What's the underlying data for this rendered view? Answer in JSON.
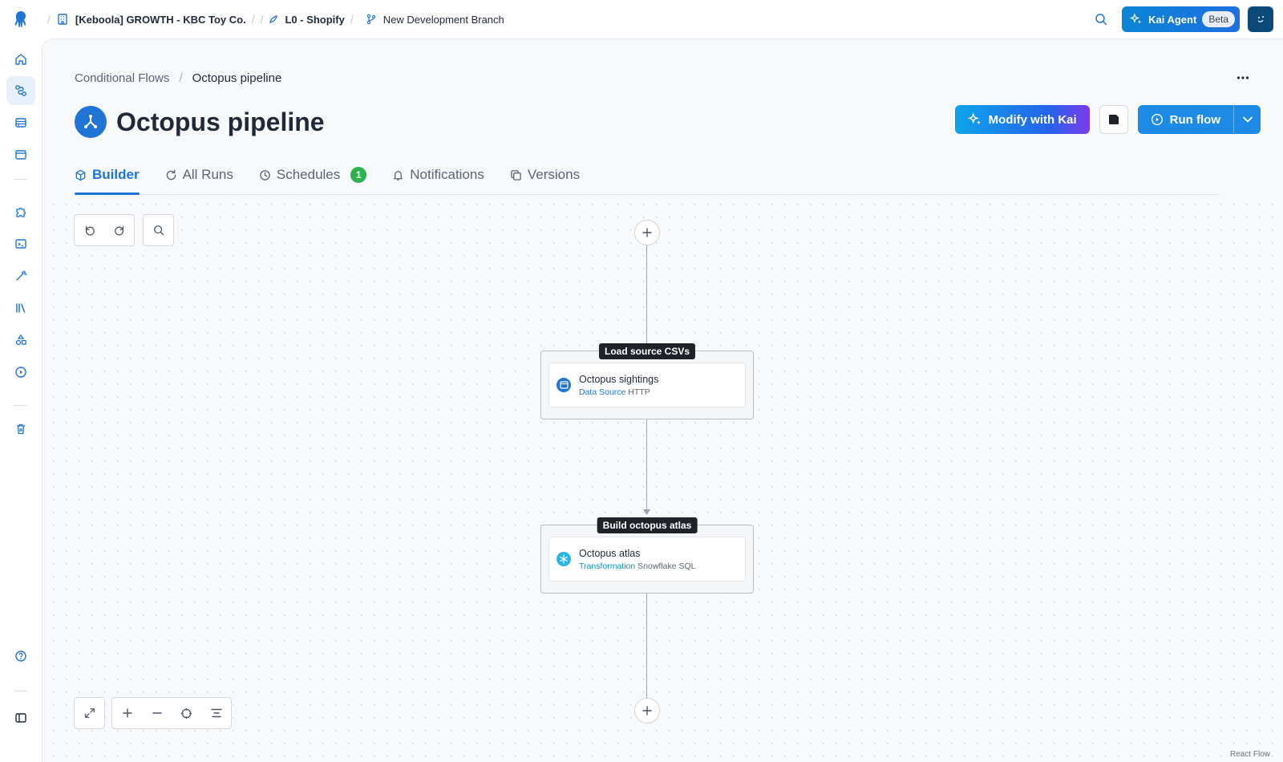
{
  "topbar": {
    "org": "[Keboola] GROWTH - KBC Toy Co.",
    "project": "L0 - Shopify",
    "branch": "New Development Branch",
    "kai_label": "Kai Agent",
    "kai_badge": "Beta"
  },
  "sidebar": {
    "items": [
      "home-icon",
      "flows-icon",
      "storage-icon",
      "components-icon",
      "puzzle-icon",
      "terminal-icon",
      "magic-wand-icon",
      "library-icon",
      "shapes-icon",
      "play-circle-icon",
      "trash-icon",
      "help-icon",
      "panel-toggle-icon"
    ],
    "active": "flows-icon"
  },
  "breadcrumb": {
    "parent": "Conditional Flows",
    "current": "Octopus pipeline"
  },
  "page": {
    "title": "Octopus pipeline"
  },
  "actions": {
    "modify_label": "Modify with Kai",
    "run_label": "Run flow"
  },
  "tabs": [
    {
      "label": "Builder",
      "icon": "cube-icon",
      "active": true
    },
    {
      "label": "All Runs",
      "icon": "refresh-icon",
      "active": false
    },
    {
      "label": "Schedules",
      "icon": "clock-icon",
      "active": false,
      "badge": "1"
    },
    {
      "label": "Notifications",
      "icon": "bell-icon",
      "active": false
    },
    {
      "label": "Versions",
      "icon": "copy-icon",
      "active": false
    }
  ],
  "flow": {
    "phases": [
      {
        "label": "Load source CSVs",
        "task": {
          "name": "Octopus sightings",
          "type": "Data Source",
          "component": "HTTP",
          "icon": "data-source-icon"
        }
      },
      {
        "label": "Build octopus atlas",
        "task": {
          "name": "Octopus atlas",
          "type": "Transformation",
          "component": "Snowflake SQL",
          "icon": "snowflake-icon"
        }
      }
    ]
  },
  "canvas": {
    "attribution": "React Flow"
  },
  "colors": {
    "accent": "#1f74d6",
    "badge_green": "#2bb24c",
    "phase_label_bg": "#1f2329"
  }
}
